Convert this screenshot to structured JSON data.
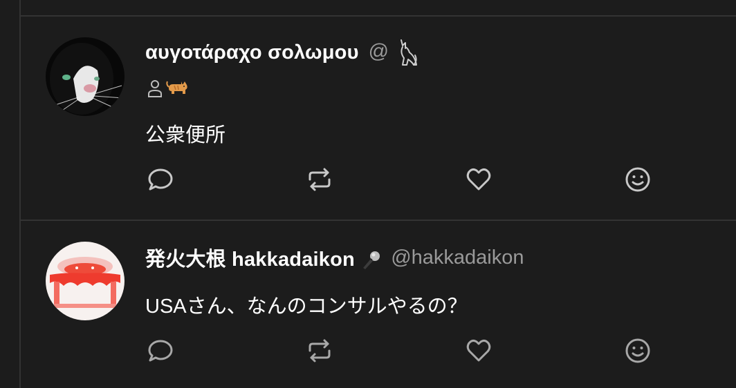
{
  "posts": [
    {
      "display_name": "αυγοτάραχο σολωμου",
      "handle": "@",
      "handle_icon": "cat-icon",
      "badges": [
        "person-icon",
        "cat-emoji-icon"
      ],
      "text": "公衆便所",
      "avatar": "black-white-cat-avatar"
    },
    {
      "display_name": "発火大根 hakkadaikon",
      "name_icon": "microphone-icon",
      "handle": "@hakkadaikon",
      "text": "USAさん、なんのコンサルやるの？",
      "avatar": "red-cloth-avatar"
    }
  ],
  "actions": [
    "reply-icon",
    "repost-icon",
    "like-icon",
    "react-icon"
  ],
  "colors": {
    "background": "#1c1c1c",
    "separator": "#333333",
    "text": "#ffffff",
    "muted": "#9a9a9a",
    "icon": "#c8c8c8"
  }
}
